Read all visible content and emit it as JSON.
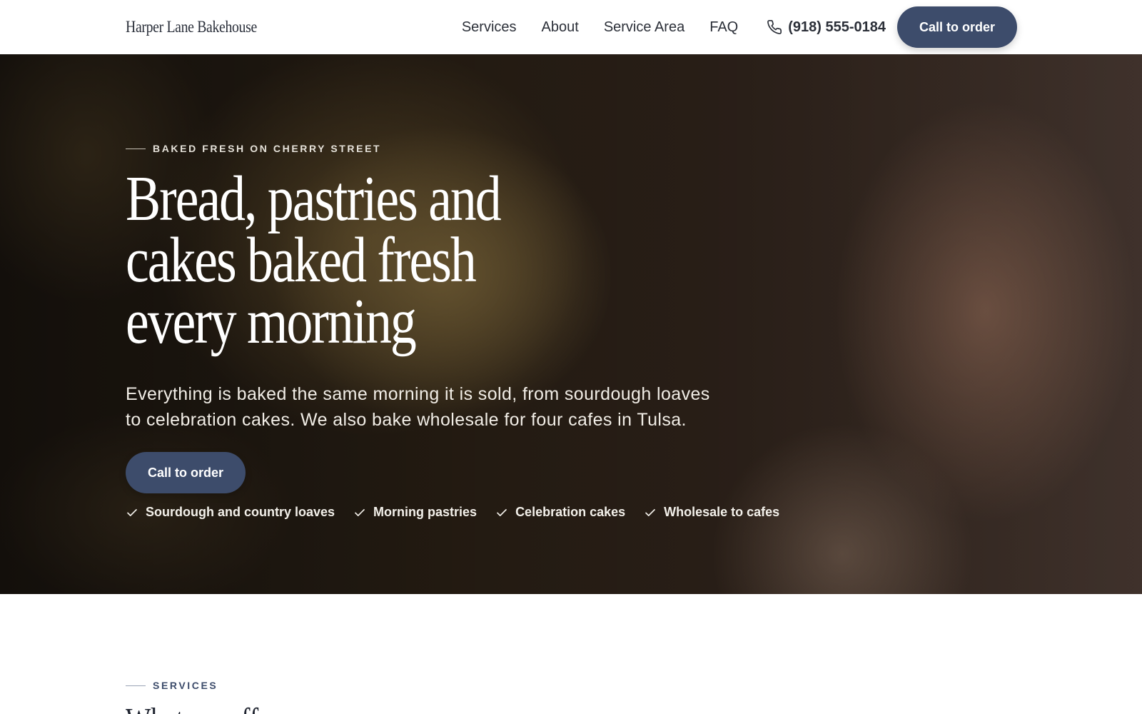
{
  "header": {
    "logo": "Harper Lane Bakehouse",
    "nav": [
      "Services",
      "About",
      "Service Area",
      "FAQ"
    ],
    "phone": "(918) 555-0184",
    "cta_label": "Call to order"
  },
  "hero": {
    "eyebrow": "BAKED FRESH ON CHERRY STREET",
    "headline": "Bread, pastries and cakes baked fresh every morning",
    "subtext": "Everything is baked the same morning it is sold, from sourdough loaves to celebration cakes. We also bake wholesale for four cafes in Tulsa.",
    "cta_label": "Call to order",
    "features": [
      "Sourdough and country loaves",
      "Morning pastries",
      "Celebration cakes",
      "Wholesale to cafes"
    ]
  },
  "services": {
    "eyebrow": "SERVICES",
    "heading": "What we offer"
  },
  "colors": {
    "accent": "#3d4c6b",
    "text_dark": "#2b2f38"
  }
}
